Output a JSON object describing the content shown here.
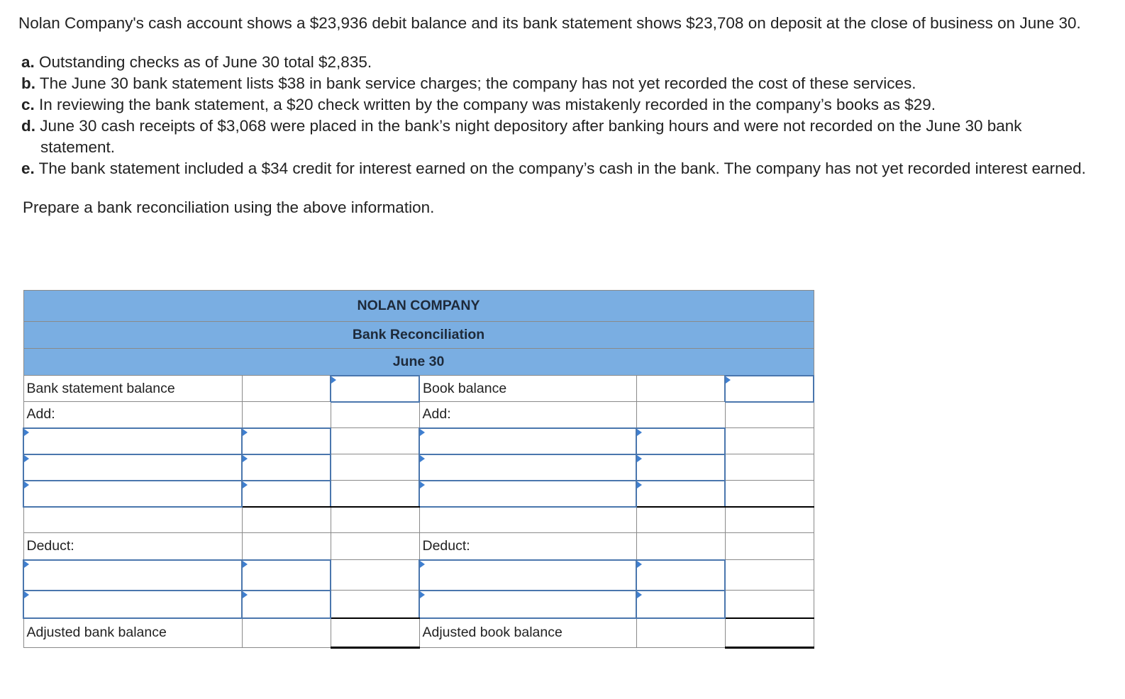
{
  "problem": {
    "intro": "Nolan Company's cash account shows a $23,936 debit balance and its bank statement shows $23,708 on deposit at the close of business on June 30.",
    "items": [
      {
        "letter": "a.",
        "text": "Outstanding checks as of June 30 total $2,835."
      },
      {
        "letter": "b.",
        "text": "The June 30 bank statement lists $38 in bank service charges; the company has not yet recorded the cost of these services."
      },
      {
        "letter": "c.",
        "text": "In reviewing the bank statement, a $20 check written by the company was mistakenly recorded in the company’s books as $29."
      },
      {
        "letter": "d.",
        "text": "June 30 cash receipts of $3,068 were placed in the bank’s night depository after banking hours and were not recorded on the June 30 bank statement."
      },
      {
        "letter": "e.",
        "text": "The bank statement included a $34 credit for interest earned on the company’s cash in the bank. The company has not yet recorded interest earned."
      }
    ],
    "instruction": "Prepare a bank reconciliation using the above information."
  },
  "reconciliation": {
    "company": "NOLAN COMPANY",
    "title": "Bank Reconciliation",
    "date": "June 30",
    "bank_side": {
      "balance_label": "Bank statement balance",
      "add_label": "Add:",
      "deduct_label": "Deduct:",
      "adjusted_label": "Adjusted bank balance"
    },
    "book_side": {
      "balance_label": "Book balance",
      "add_label": "Add:",
      "deduct_label": "Deduct:",
      "adjusted_label": "Adjusted book balance"
    }
  },
  "colors": {
    "header_fill": "#7aaee2",
    "input_border": "#4a76ad",
    "input_marker": "#3f7fd0"
  }
}
